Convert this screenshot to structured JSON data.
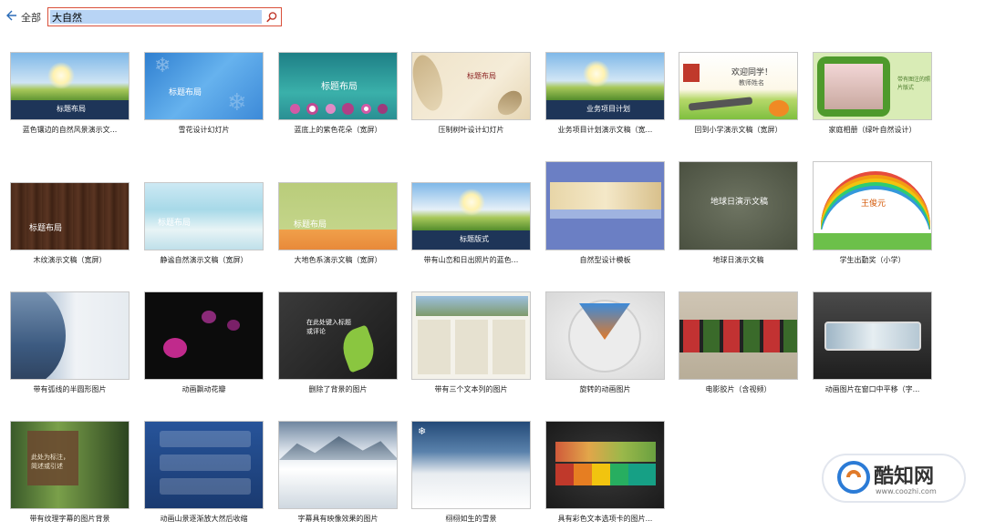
{
  "header": {
    "breadcrumb": "全部",
    "search_value": "大自然"
  },
  "templates": [
    {
      "caption": "蓝色镶边的自然风景演示文...",
      "title": "标题布局"
    },
    {
      "caption": "雪花设计幻灯片",
      "title": "标题布局"
    },
    {
      "caption": "蓝底上的紫色花朵（宽屏）",
      "title": "标题布局"
    },
    {
      "caption": "压制树叶设计幻灯片",
      "title": "标题布局"
    },
    {
      "caption": "业务项目计划演示文稿（宽...",
      "title": "业务项目计划"
    },
    {
      "caption": "回到小学演示文稿（宽屏）",
      "title": "欢迎同学！",
      "subtitle": "教师姓名"
    },
    {
      "caption": "家庭相册（绿叶自然设计）",
      "title": "带有图注的照片版式"
    },
    {
      "caption": "木纹演示文稿（宽屏）",
      "title": "标题布局"
    },
    {
      "caption": "静谧自然演示文稿（宽屏）",
      "title": "标题布局"
    },
    {
      "caption": "大地色系演示文稿（宽屏）",
      "title": "标题布局"
    },
    {
      "caption": "带有山峦和日出照片的蓝色...",
      "title": "标题版式"
    },
    {
      "caption": "自然型设计模板",
      "title": ""
    },
    {
      "caption": "地球日演示文稿",
      "title": "地球日演示文稿"
    },
    {
      "caption": "学生出勤奖（小学）",
      "title": "王俊元"
    },
    {
      "caption": "带有弧线的半圆形图片",
      "title": ""
    },
    {
      "caption": "动画飘动花瓣",
      "title": ""
    },
    {
      "caption": "删除了背景的图片",
      "title": "在此处键入标题或评论"
    },
    {
      "caption": "带有三个文本列的图片",
      "title": ""
    },
    {
      "caption": "旋转的动画图片",
      "title": ""
    },
    {
      "caption": "电影胶片（含视频）",
      "title": ""
    },
    {
      "caption": "动画图片在窗口中平移（字...",
      "title": ""
    },
    {
      "caption": "带有纹理字幕的图片背景",
      "title": "此处为标注，简述或引述"
    },
    {
      "caption": "动画山景逐渐放大然后收缩",
      "title": ""
    },
    {
      "caption": "字幕具有映像效果的图片",
      "title": ""
    },
    {
      "caption": "栩栩如生的雪景",
      "title": ""
    },
    {
      "caption": "具有彩色文本选项卡的图片...",
      "title": ""
    }
  ],
  "watermark": {
    "brand": "酷知网",
    "url": "www.coozhi.com"
  },
  "colors": {
    "search_border": "#d9503a",
    "selection": "#b8d4f5",
    "back_arrow": "#2b6cb8"
  }
}
